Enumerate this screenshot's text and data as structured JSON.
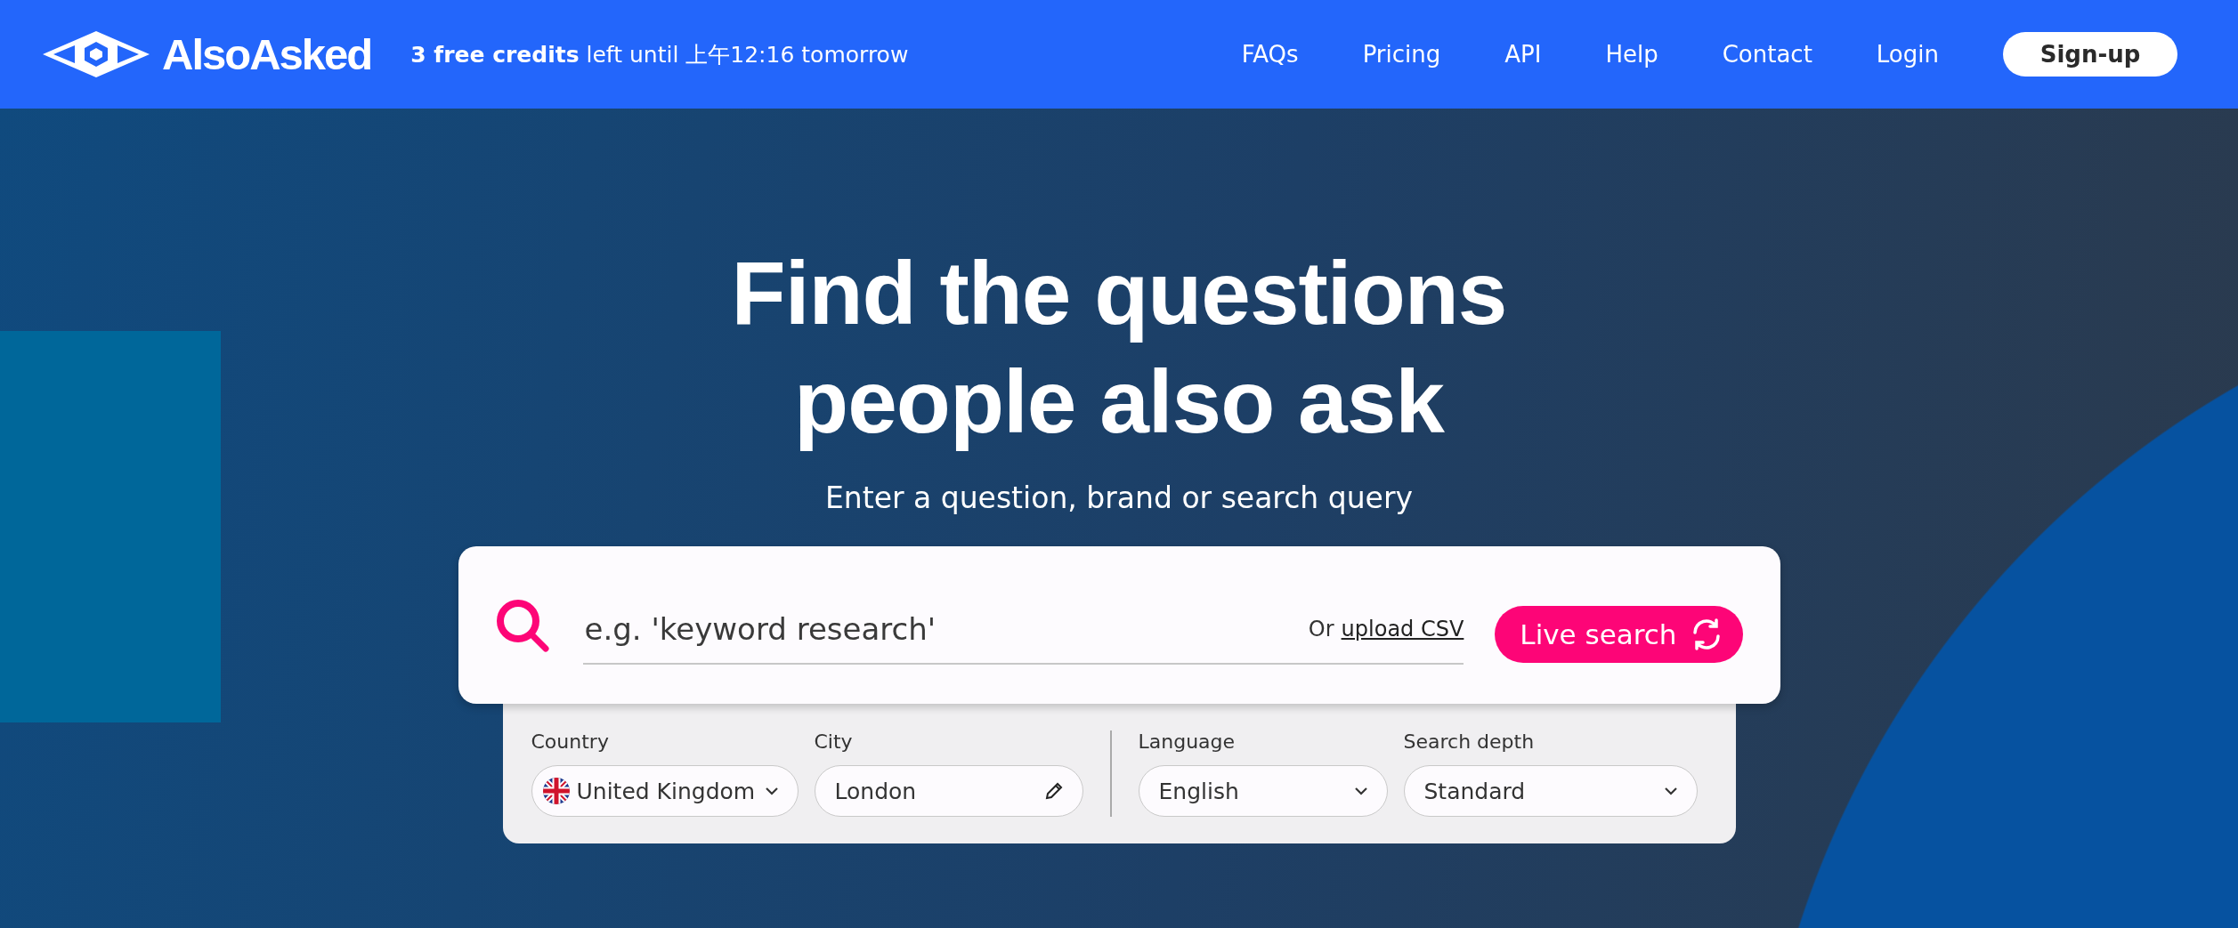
{
  "header": {
    "logo": "AlsoAsked",
    "credits": "**3 free credits** left until 上午12:16 tomorrow",
    "nav": [
      "FAQs",
      "Pricing",
      "API",
      "Help",
      "Contact",
      "Login"
    ],
    "signup": "Sign-up"
  },
  "hero": {
    "title_lines": [
      "Find the questions",
      "people also ask"
    ],
    "subtitle": "Enter a question, brand or search query"
  },
  "search": {
    "placeholder": "e.g. 'keyword research'",
    "upload_prefix": "Or",
    "upload_link": "upload CSV",
    "button": "Live search"
  },
  "option_groups": [
    {
      "fields": [
        {
          "label": "Country",
          "kind": "country",
          "value": "United Kingdom"
        },
        {
          "label": "City",
          "kind": "text",
          "value": "London"
        }
      ]
    },
    {
      "fields": [
        {
          "label": "Language",
          "kind": "select",
          "value": "English"
        },
        {
          "label": "Search depth",
          "kind": "select",
          "value": "Standard"
        }
      ]
    }
  ]
}
